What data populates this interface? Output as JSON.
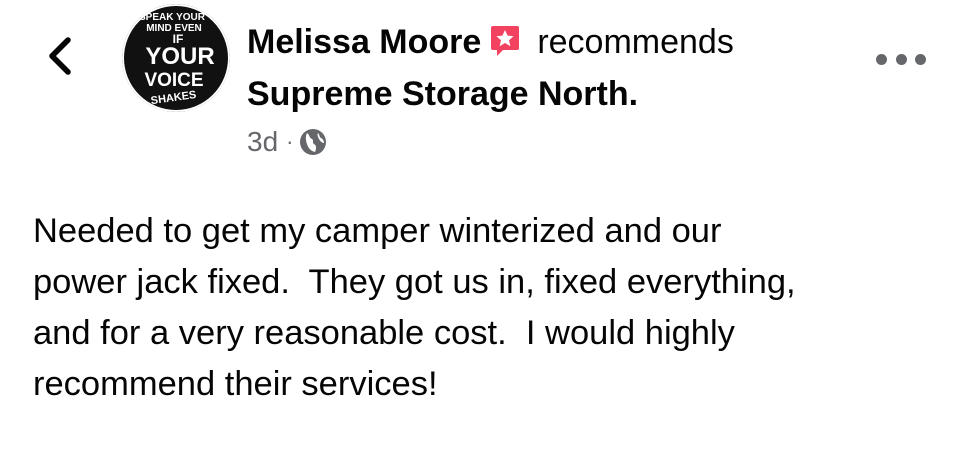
{
  "post": {
    "author_name": "Melissa Moore",
    "action_text": "recommends",
    "page_name": "Supreme Storage North.",
    "timestamp": "3d",
    "separator": "·",
    "privacy_icon": "globe-icon",
    "recommend_icon": "star-badge-icon",
    "more_icon": "more-dots-icon",
    "back_icon": "chevron-left-icon",
    "body_text": "Needed to get my camper winterized and our\npower jack fixed.  They got us in, fixed everything,\nand for a very reasonable cost.  I would highly\nrecommend their services!"
  },
  "avatar": {
    "text_lines": [
      "SPEAK YOUR",
      "MIND EVEN",
      "IF",
      "YOUR",
      "VOICE",
      "SHAKES"
    ]
  },
  "colors": {
    "text_primary": "#050505",
    "text_secondary": "#65676b",
    "recommend_badge": "#f3425f",
    "avatar_bg": "#111111"
  }
}
